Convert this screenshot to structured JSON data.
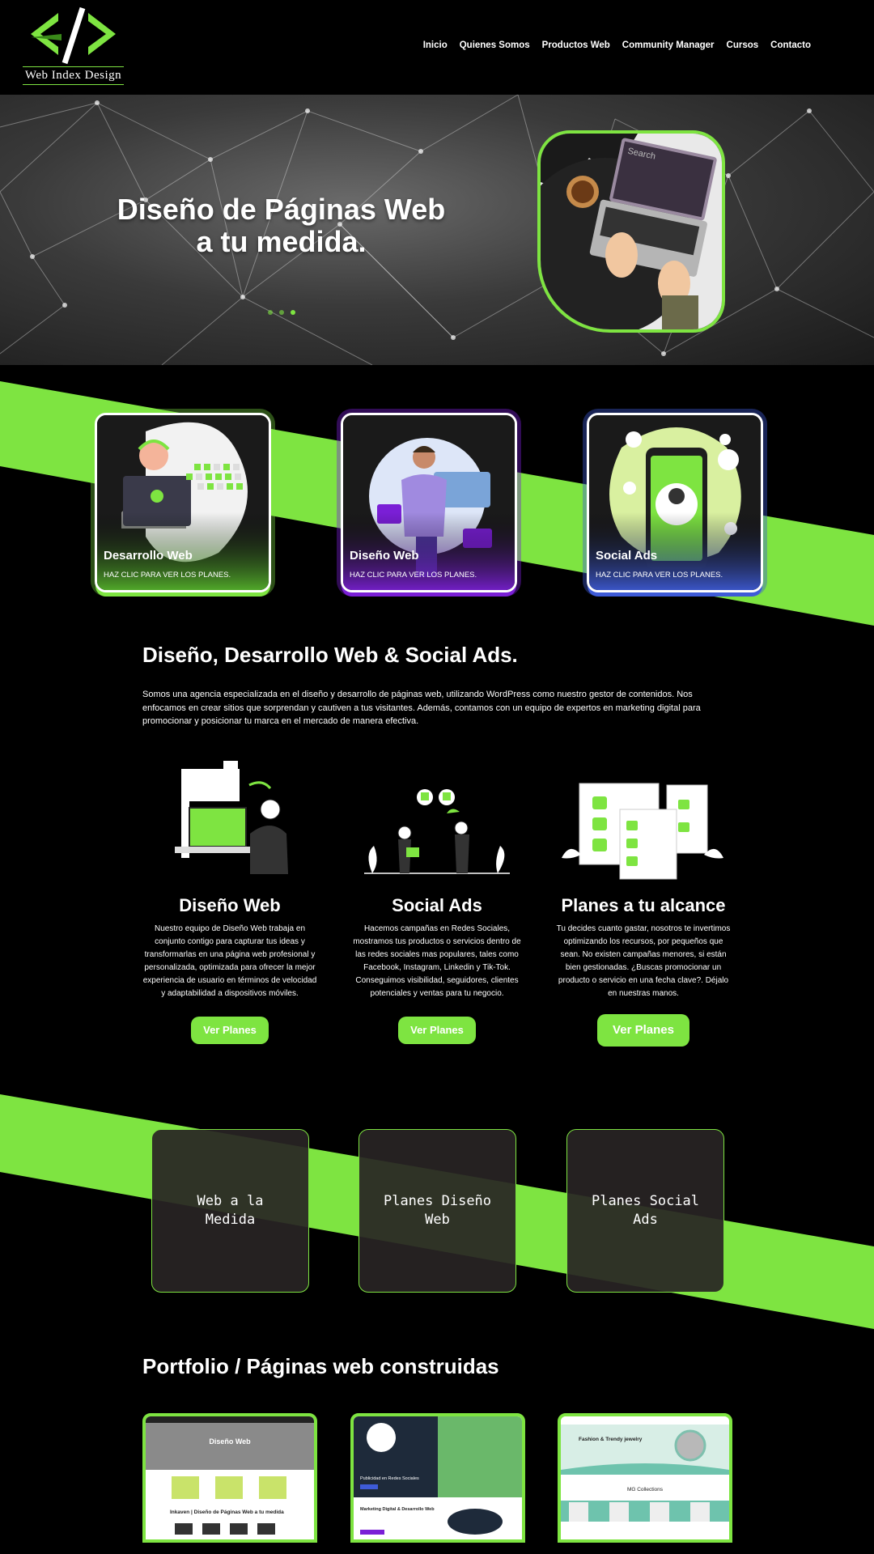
{
  "header": {
    "logo_text": "Web Index Design",
    "nav": [
      "Inicio",
      "Quienes Somos",
      "Productos Web",
      "Community Manager",
      "Cursos",
      "Contacto"
    ]
  },
  "hero": {
    "title": "Diseño de Páginas Web a tu medida.",
    "search_text": "Search"
  },
  "cards": [
    {
      "title": "Desarrollo Web",
      "sub": "HAZ CLIC PARA VER LOS PLANES."
    },
    {
      "title": "Diseño Web",
      "sub": "HAZ CLIC PARA VER LOS PLANES."
    },
    {
      "title": "Social Ads",
      "sub": "HAZ CLIC PARA VER LOS PLANES."
    }
  ],
  "intro": {
    "title": "Diseño, Desarrollo Web & Social Ads.",
    "text": "Somos una agencia especializada en el diseño y desarrollo de páginas web, utilizando WordPress como nuestro  gestor de contenidos. Nos enfocamos en crear sitios que sorprendan y cautiven a tus visitantes. Además, contamos con un equipo de expertos en marketing digital para promocionar y posicionar tu marca en el mercado de manera efectiva."
  },
  "features": [
    {
      "title": "Diseño Web",
      "text": "Nuestro equipo de Diseño Web trabaja en conjunto contigo para capturar tus ideas y transformarlas en una página web profesional y personalizada, optimizada para ofrecer la mejor experiencia de usuario en términos de velocidad y adaptabilidad a dispositivos móviles.",
      "button": "Ver Planes"
    },
    {
      "title": "Social Ads",
      "text": "Hacemos campañas en Redes Sociales, mostramos tus productos o servicios dentro de las redes sociales mas populares, tales como Facebook, Instagram, Linkedin y Tik-Tok. Conseguimos visibilidad, seguidores, clientes potenciales y ventas para tu negocio.",
      "button": "Ver Planes"
    },
    {
      "title": "Planes a tu alcance",
      "text": "Tu decides cuanto gastar, nosotros te invertimos optimizando los recursos, por pequeños que sean. No existen campañas menores, si están bien gestionadas. ¿Buscas promocionar un producto o servicio en una fecha clave?. Déjalo en nuestras manos.",
      "button": "Ver Planes"
    }
  ],
  "plans": [
    "Web a la Medida",
    "Planes Diseño Web",
    "Planes Social Ads"
  ],
  "portfolio": {
    "title": "Portfolio / Páginas web construidas",
    "items": [
      {
        "heading": "Diseño Web",
        "sub": "Inkaven | Diseño de Páginas Web a tu medida"
      },
      {
        "heading": "Marketing Digital & Desarrollo Web",
        "sub": "Publicidad en Redes Sociales"
      },
      {
        "heading": "Fashion & Trendy jewelry",
        "sub": "MG Collections"
      }
    ]
  },
  "colors": {
    "accent": "#7ee441",
    "purple": "#7a1fd6",
    "blue": "#3e5bd8"
  }
}
